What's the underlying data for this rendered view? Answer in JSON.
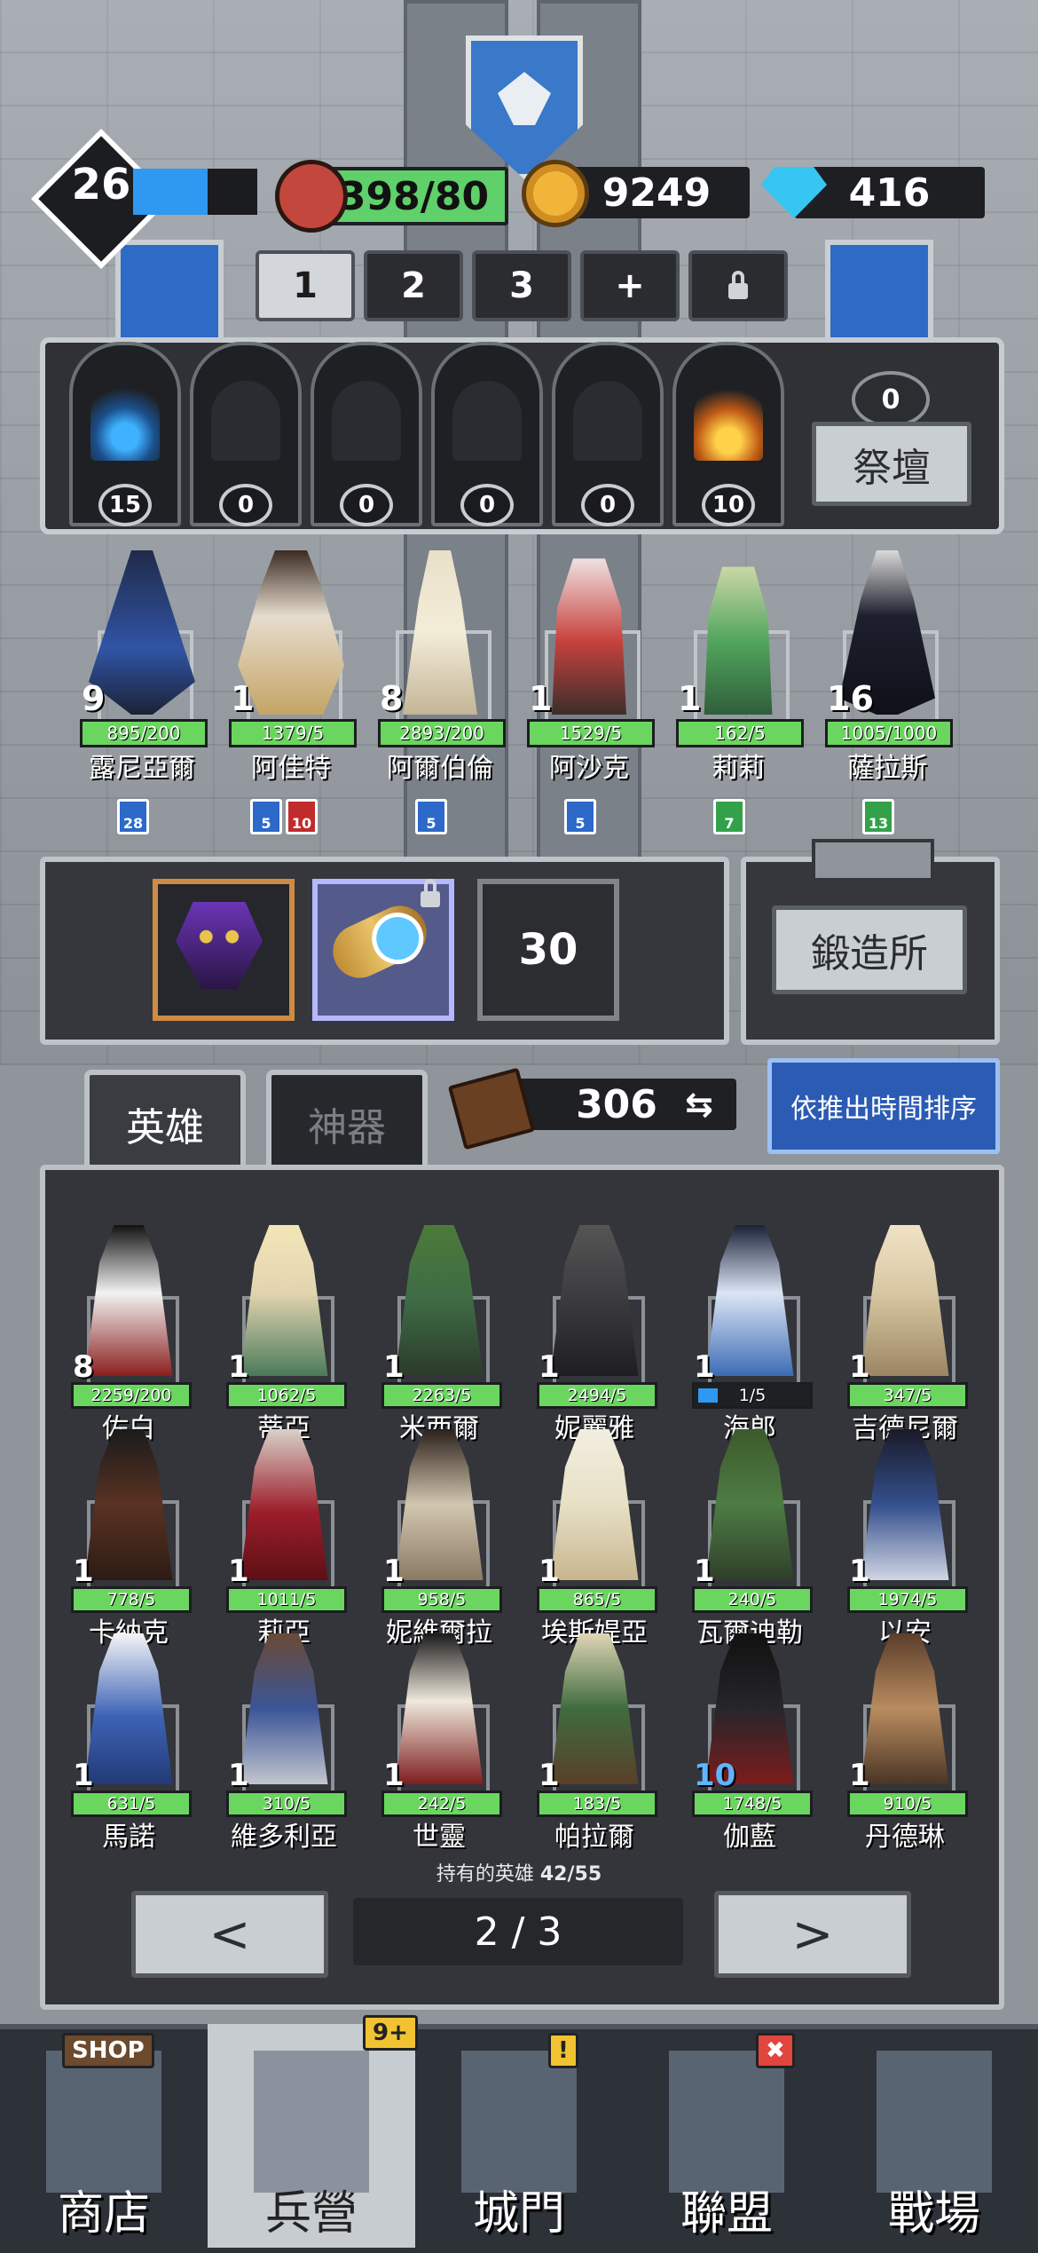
{
  "resources": {
    "level": "26",
    "xp_fraction": 0.6,
    "food": "398/80",
    "gold": "9249",
    "gems": "416"
  },
  "team_tabs": [
    "1",
    "2",
    "3",
    "+"
  ],
  "altar": {
    "shrine_counts": [
      "15",
      "0",
      "0",
      "0",
      "0",
      "10"
    ],
    "altar_count": "0",
    "altar_label": "祭壇"
  },
  "team_heroes": [
    {
      "level": "9",
      "progress": "895/200",
      "name": "露尼亞爾",
      "classes": [
        {
          "color": "b",
          "value": "28"
        }
      ]
    },
    {
      "level": "1",
      "progress": "1379/5",
      "name": "阿佳特",
      "classes": [
        {
          "color": "b",
          "value": "5"
        },
        {
          "color": "r",
          "value": "10"
        }
      ]
    },
    {
      "level": "8",
      "progress": "2893/200",
      "name": "阿爾伯倫",
      "classes": [
        {
          "color": "b",
          "value": "5"
        }
      ]
    },
    {
      "level": "1",
      "progress": "1529/5",
      "name": "阿沙克",
      "classes": [
        {
          "color": "b",
          "value": "5"
        }
      ]
    },
    {
      "level": "1",
      "progress": "162/5",
      "name": "莉莉",
      "classes": [
        {
          "color": "g",
          "value": "7"
        }
      ]
    },
    {
      "level": "16",
      "progress": "1005/1000",
      "name": "薩拉斯",
      "classes": [
        {
          "color": "g",
          "value": "13"
        }
      ]
    }
  ],
  "equipment": {
    "locked_slot_level": "30",
    "forge_label": "鍛造所"
  },
  "tabs": {
    "heroes": "英雄",
    "artifacts": "神器",
    "book_count": "306",
    "sort_label": "依推出時間排序"
  },
  "hero_grid": [
    {
      "level": "8",
      "progress": "2259/200",
      "name": "佐白"
    },
    {
      "level": "1",
      "progress": "1062/5",
      "name": "蒂亞"
    },
    {
      "level": "1",
      "progress": "2263/5",
      "name": "米西爾"
    },
    {
      "level": "1",
      "progress": "2494/5",
      "name": "妮麗雅"
    },
    {
      "level": "1",
      "progress": "1/5",
      "name": "海郎"
    },
    {
      "level": "1",
      "progress": "347/5",
      "name": "吉德尼爾"
    },
    {
      "level": "1",
      "progress": "778/5",
      "name": "卡納克"
    },
    {
      "level": "1",
      "progress": "1011/5",
      "name": "莉亞"
    },
    {
      "level": "1",
      "progress": "958/5",
      "name": "妮維爾拉"
    },
    {
      "level": "1",
      "progress": "865/5",
      "name": "埃斯媞亞"
    },
    {
      "level": "1",
      "progress": "240/5",
      "name": "瓦爾迪勒"
    },
    {
      "level": "1",
      "progress": "1974/5",
      "name": "以安"
    },
    {
      "level": "1",
      "progress": "631/5",
      "name": "馬諾"
    },
    {
      "level": "1",
      "progress": "310/5",
      "name": "維多利亞"
    },
    {
      "level": "1",
      "progress": "242/5",
      "name": "世靈"
    },
    {
      "level": "1",
      "progress": "183/5",
      "name": "帕拉爾"
    },
    {
      "level": "10",
      "progress": "1748/5",
      "name": "伽藍"
    },
    {
      "level": "1",
      "progress": "910/5",
      "name": "丹德琳"
    }
  ],
  "owned": {
    "label": "持有的英雄",
    "count": "42/55"
  },
  "pagination": {
    "prev": "<",
    "page": "2 / 3",
    "next": ">"
  },
  "bottom_nav": [
    {
      "label": "商店",
      "icon": "shop-building-icon",
      "sign": "SHOP"
    },
    {
      "label": "兵營",
      "icon": "barracks-castle-icon",
      "badge": "9+"
    },
    {
      "label": "城門",
      "icon": "castle-gate-icon",
      "badge": "!"
    },
    {
      "label": "聯盟",
      "icon": "alliance-tower-icon",
      "badge": "✖"
    },
    {
      "label": "戰場",
      "icon": "battlefield-swords-icon"
    }
  ],
  "colors": {
    "accent_blue": "#2b5bb3",
    "progress_green": "#6ad65f",
    "xp_blue": "#2f98f1"
  }
}
